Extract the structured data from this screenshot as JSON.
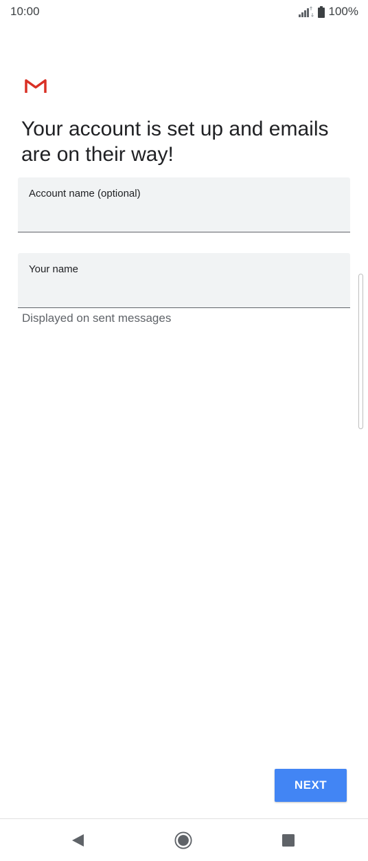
{
  "status_bar": {
    "time": "10:00",
    "battery_percent": "100%",
    "icons": [
      "signal-icon",
      "battery-icon"
    ]
  },
  "app": {
    "logo": "gmail-logo-icon",
    "colors": {
      "gmail_red": "#d93025",
      "accent": "#4285f4",
      "field_bg": "#f1f3f4"
    }
  },
  "main": {
    "headline": "Your account is set up and emails are on their way!",
    "fields": [
      {
        "label": "Account name (optional)",
        "value": ""
      },
      {
        "label": "Your name",
        "value": "",
        "helper": "Displayed on sent messages"
      }
    ]
  },
  "footer": {
    "next_label": "NEXT"
  },
  "nav_bar": {
    "icons": [
      "back-icon",
      "home-icon",
      "recents-icon"
    ]
  }
}
